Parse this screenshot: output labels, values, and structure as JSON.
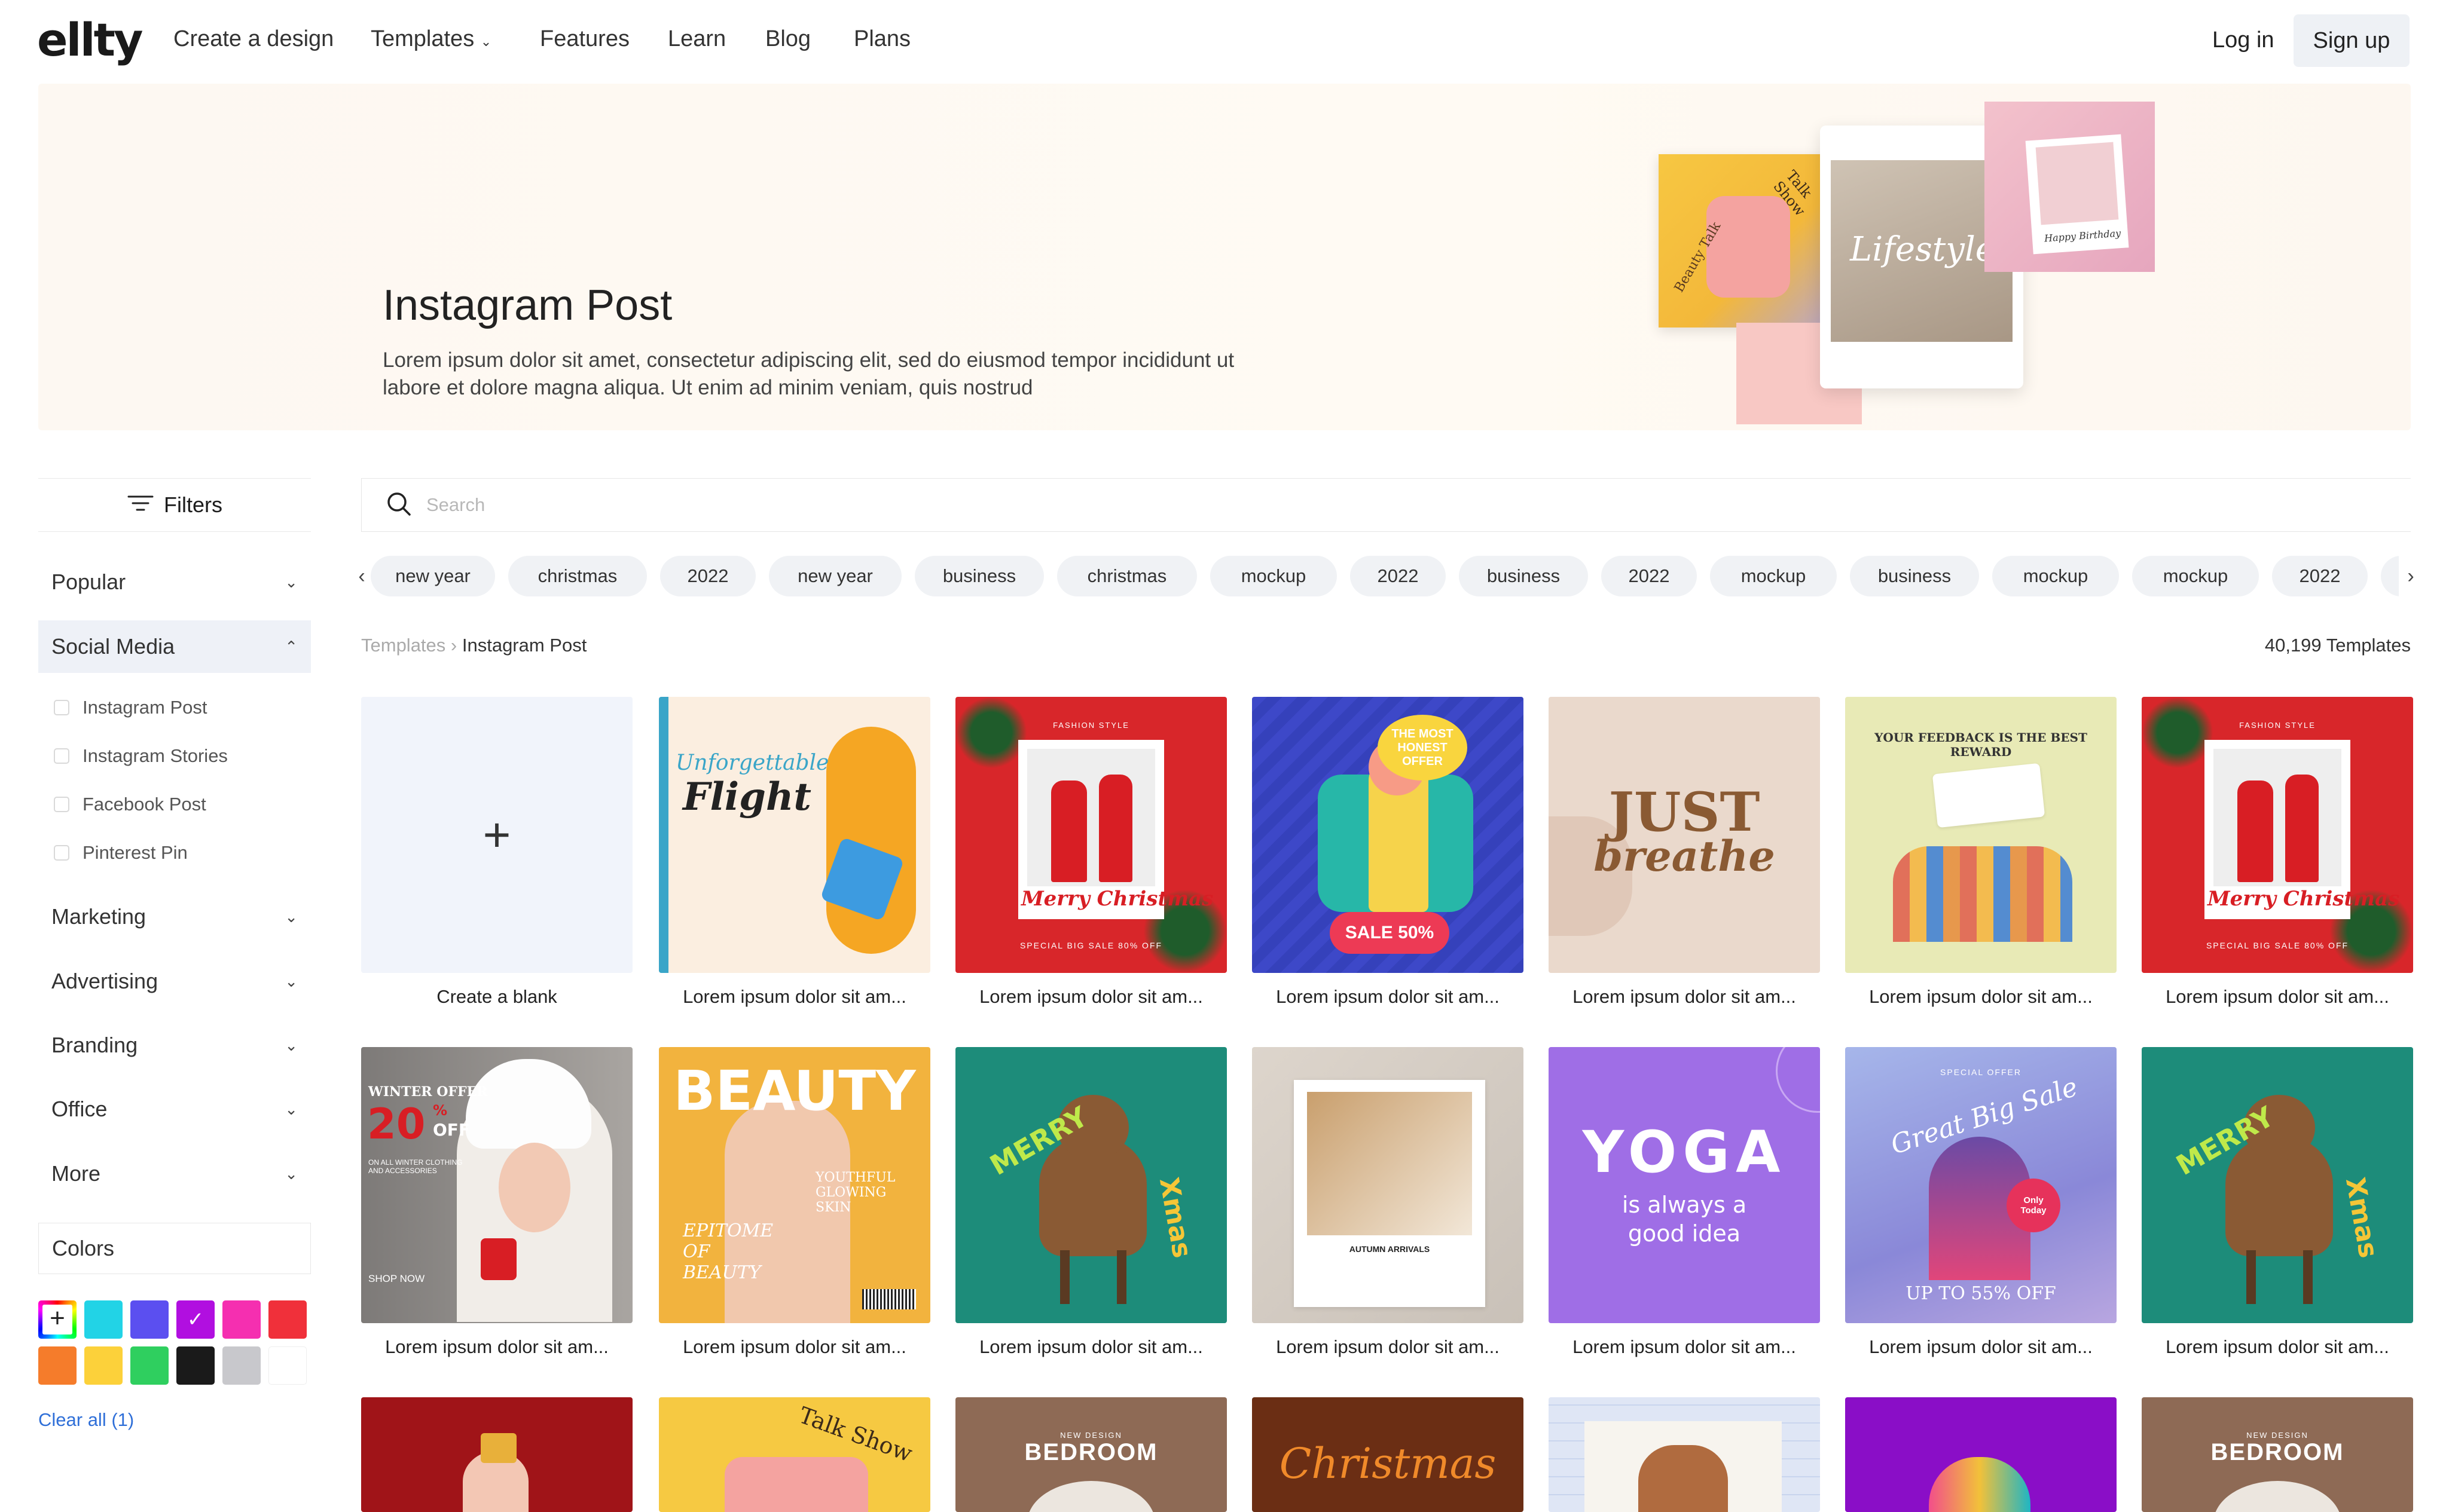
{
  "header": {
    "logo": "ellty",
    "nav": [
      {
        "label": "Create a design"
      },
      {
        "label": "Templates"
      },
      {
        "label": "Features"
      },
      {
        "label": "Learn"
      },
      {
        "label": "Blog"
      },
      {
        "label": "Plans"
      }
    ],
    "login_label": "Log in",
    "signup_label": "Sign up"
  },
  "hero": {
    "title": "Instagram Post",
    "description": "Lorem ipsum dolor sit amet, consectetur adipiscing elit, sed do eiusmod tempor incididunt ut labore et dolore magna aliqua. Ut enim ad minim veniam, quis nostrud",
    "collage": {
      "left_text": "Talk Show",
      "left_sub": "Beauty Talk",
      "center_text": "Lifestyle",
      "right_text": "Happy Birthday"
    }
  },
  "sidebar": {
    "filters_label": "Filters",
    "categories": [
      {
        "label": "Popular",
        "expanded": false
      },
      {
        "label": "Social Media",
        "expanded": true
      },
      {
        "label": "Marketing",
        "expanded": false
      },
      {
        "label": "Advertising",
        "expanded": false
      },
      {
        "label": "Branding",
        "expanded": false
      },
      {
        "label": "Office",
        "expanded": false
      },
      {
        "label": "More",
        "expanded": false
      }
    ],
    "social_media_items": [
      "Instagram Post",
      "Instagram Stories",
      "Facebook Post",
      "Pinterest Pin"
    ],
    "colors_label": "Colors",
    "colors": [
      {
        "name": "custom-color",
        "hex": "#ffffff"
      },
      {
        "name": "cyan",
        "hex": "#22d3e6"
      },
      {
        "name": "indigo",
        "hex": "#5b4ff0"
      },
      {
        "name": "purple",
        "hex": "#b10fe0",
        "selected": true
      },
      {
        "name": "pink",
        "hex": "#f52fb0"
      },
      {
        "name": "red",
        "hex": "#f0303a"
      },
      {
        "name": "orange",
        "hex": "#f57c2b"
      },
      {
        "name": "yellow",
        "hex": "#fcd13a"
      },
      {
        "name": "green",
        "hex": "#2fcf5f"
      },
      {
        "name": "black",
        "hex": "#1a1a1a"
      },
      {
        "name": "gray",
        "hex": "#c8c8cc"
      },
      {
        "name": "white",
        "hex": "#ffffff"
      }
    ],
    "clear_all_label": "Clear all (1)"
  },
  "main": {
    "search_placeholder": "Search",
    "chips": [
      "new year",
      "christmas",
      "2022",
      "new year",
      "business",
      "christmas",
      "mockup",
      "2022",
      "business",
      "2022",
      "mockup",
      "business",
      "mockup",
      "mockup",
      "2022"
    ],
    "breadcrumb": {
      "root": "Templates",
      "current": "Instagram Post"
    },
    "count": "40,199 Templates",
    "blank_caption": "Create a blank",
    "card_caption": "Lorem ipsum dolor sit am...",
    "card_texts": {
      "flight_1": "Unforgettable",
      "flight_2": "Flight",
      "xmas_top": "FASHION STYLE",
      "xmas_script": "Merry Christmas",
      "xmas_bottom": "SPECIAL BIG SALE 80% OFF",
      "honest": "THE MOST HONEST OFFER",
      "sale": "SALE 50%",
      "just": "JUST",
      "breathe": "breathe",
      "feedback": "YOUR FEEDBACK IS THE BEST REWARD",
      "winter_1": "WINTER OFFER",
      "winter_2": "20",
      "winter_3": "OFF",
      "winter_4": "ON ALL WINTER CLOTHING AND ACCESSORIES",
      "winter_5": "SHOP NOW",
      "beauty": "BEAUTY",
      "beauty_sub": "EPITOME OF BEAUTY",
      "beauty_side": "YOUTHFUL GLOWING SKIN",
      "merry": "MERRY",
      "xmas": "Xmas",
      "autumn": "AUTUMN ARRIVALS",
      "yoga": "YOGA",
      "yoga_sub": "is always a good idea",
      "bigsale_tag": "SPECIAL OFFER",
      "bigsale": "Great Big Sale",
      "bigsale_off": "UP TO 55% OFF",
      "bigsale_badge": "Only Today",
      "bedroom_small": "NEW DESIGN",
      "bedroom": "BEDROOM",
      "christmas_script": "Christmas",
      "talk_show": "Talk Show"
    }
  }
}
